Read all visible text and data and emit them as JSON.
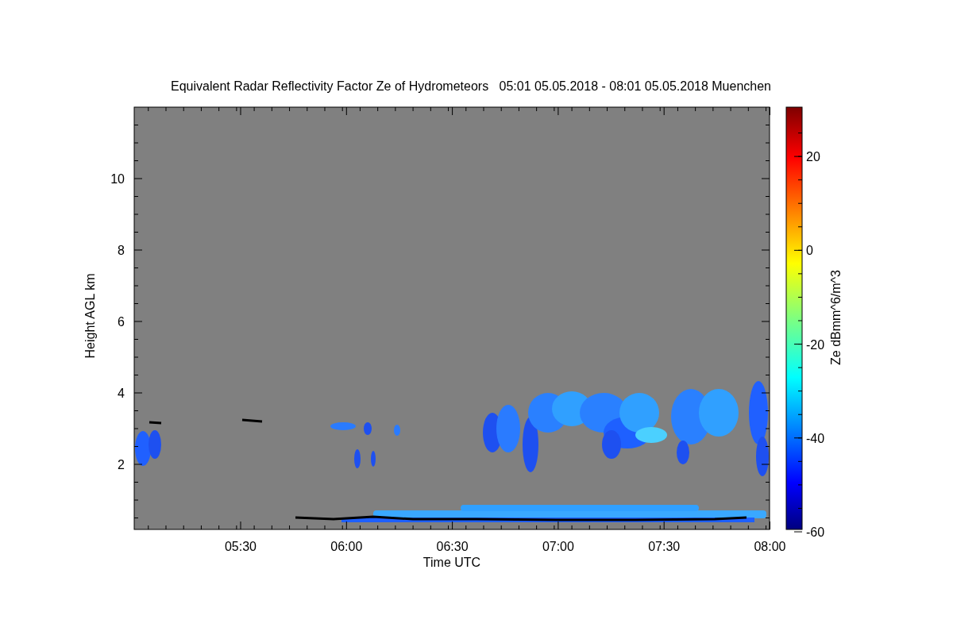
{
  "title": "Equivalent Radar Reflectivity Factor Ze of Hydrometeors   05:01 05.05.2018 - 08:01 05.05.2018 Muenchen",
  "plot": {
    "ylabel": "Height AGL km",
    "xlabel": "Time UTC",
    "yticks": [
      "10",
      "8",
      "6",
      "4",
      "2"
    ],
    "xticks": [
      "05:30",
      "06:00",
      "06:30",
      "07:00",
      "07:30",
      "08:00"
    ]
  },
  "colorbar": {
    "label": "Ze dBmm^6/m^3",
    "ticks": [
      "20",
      "0",
      "-20",
      "-40",
      "-60"
    ]
  }
}
